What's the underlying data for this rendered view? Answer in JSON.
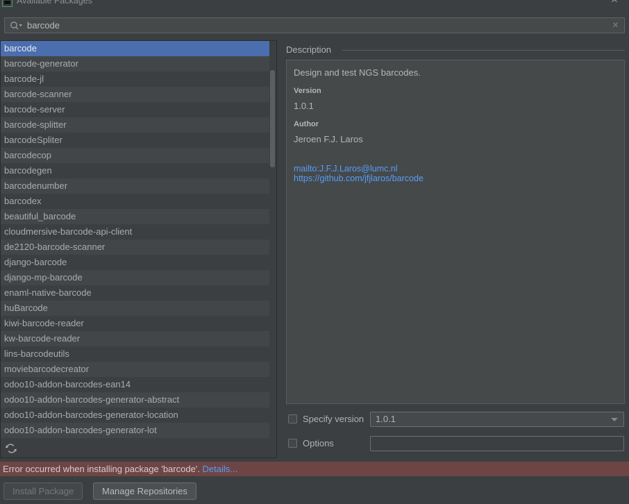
{
  "window": {
    "title": "Available Packages",
    "close_label": "✕",
    "icon_name": "package-window-icon"
  },
  "search": {
    "value": "barcode",
    "placeholder": "",
    "icon_name": "search-icon",
    "clear_label": "✕"
  },
  "list": {
    "selected_index": 0,
    "items": [
      "barcode",
      "barcode-generator",
      "barcode-jl",
      "barcode-scanner",
      "barcode-server",
      "barcode-splitter",
      "barcodeSpliter",
      "barcodecop",
      "barcodegen",
      "barcodenumber",
      "barcodex",
      "beautiful_barcode",
      "cloudmersive-barcode-api-client",
      "de2120-barcode-scanner",
      "django-barcode",
      "django-mp-barcode",
      "enaml-native-barcode",
      "huBarcode",
      "kiwi-barcode-reader",
      "kw-barcode-reader",
      "lins-barcodeutils",
      "moviebarcodecreator",
      "odoo10-addon-barcodes-ean14",
      "odoo10-addon-barcodes-generator-abstract",
      "odoo10-addon-barcodes-generator-location",
      "odoo10-addon-barcodes-generator-lot"
    ],
    "refresh_icon": "refresh-icon"
  },
  "description": {
    "header": "Description",
    "summary": "Design and test NGS barcodes.",
    "version_label": "Version",
    "version_value": "1.0.1",
    "author_label": "Author",
    "author_value": "Jeroen F.J. Laros",
    "links": [
      "mailto:J.F.J.Laros@lumc.nl",
      "https://github.com/jfjlaros/barcode"
    ]
  },
  "options": {
    "specify_version_label": "Specify version",
    "specify_version_checked": false,
    "version_selected": "1.0.1",
    "options_label": "Options",
    "options_checked": false,
    "options_value": "",
    "options_placeholder": ""
  },
  "status": {
    "error_text": "Error occurred when installing package 'barcode'.",
    "details_label": "Details...",
    "error_color": "#6e4545"
  },
  "buttons": {
    "install": "Install Package",
    "install_disabled": true,
    "manage": "Manage Repositories"
  },
  "theme": {
    "background": "#3c3f41",
    "row_alt": "#434649",
    "selection": "#4b6eaf",
    "link": "#589df6",
    "panel": "#45494a"
  }
}
